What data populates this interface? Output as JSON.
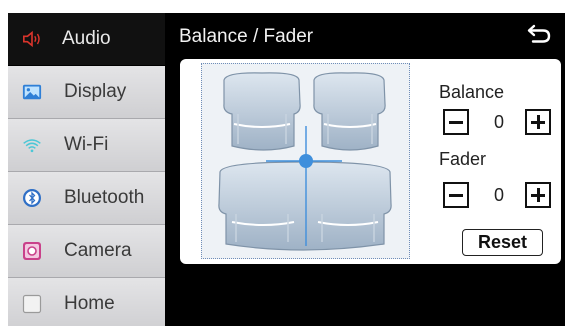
{
  "sidebar": {
    "items": [
      {
        "label": "Audio",
        "icon": "speaker-icon",
        "active": true
      },
      {
        "label": "Display",
        "icon": "image-icon",
        "active": false
      },
      {
        "label": "Wi-Fi",
        "icon": "wifi-icon",
        "active": false
      },
      {
        "label": "Bluetooth",
        "icon": "bluetooth-icon",
        "active": false
      },
      {
        "label": "Camera",
        "icon": "camera-icon",
        "active": false
      },
      {
        "label": "Home",
        "icon": "home-checkbox-icon",
        "active": false
      }
    ]
  },
  "header": {
    "title": "Balance / Fader",
    "back_icon": "back-arrow-icon"
  },
  "controls": {
    "balance": {
      "label": "Balance",
      "value": "0"
    },
    "fader": {
      "label": "Fader",
      "value": "0"
    },
    "reset_label": "Reset"
  },
  "colors": {
    "accent_red": "#d9342b",
    "marker_blue": "#3f8fdc",
    "wifi_teal": "#4cc7d6",
    "camera_pink": "#c9418a"
  }
}
